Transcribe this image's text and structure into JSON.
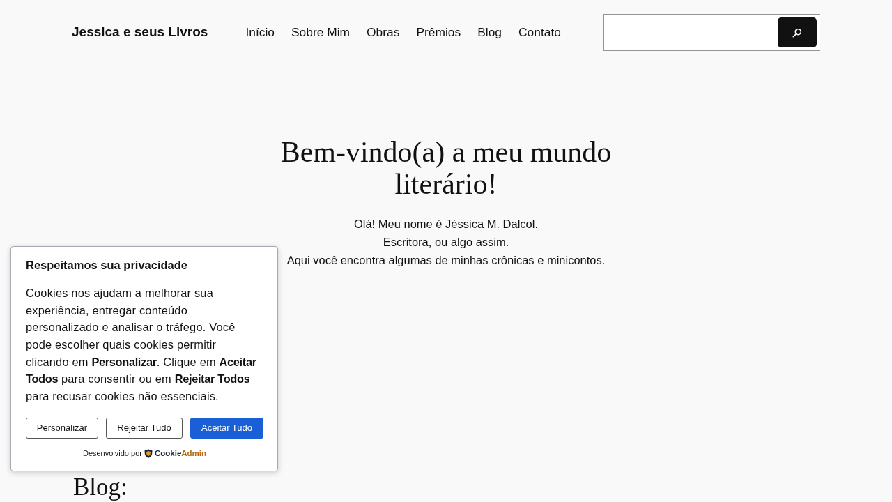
{
  "header": {
    "site_title": "Jessica e seus Livros",
    "nav": [
      {
        "label": "Início",
        "selected": false
      },
      {
        "label": "Sobre Mim",
        "selected": false
      },
      {
        "label": "Obras",
        "selected": false
      },
      {
        "label": "Prêmios",
        "selected": false
      },
      {
        "label": "Blog",
        "selected": false
      },
      {
        "label": "Contato",
        "selected": false
      }
    ]
  },
  "hero": {
    "heading": "Bem-vindo(a) a meu mundo literário!",
    "lines": [
      "Olá! Meu nome é Jéssica M. Dalcol.",
      "Escritora, ou algo assim.",
      "Aqui você encontra algumas de minhas crônicas e minicontos."
    ]
  },
  "blog_section": {
    "heading": "Blog:"
  },
  "cookie_banner": {
    "title": "Respeitamos sua privacidade",
    "message": "Cookies nos ajudam a melhorar sua experiência, entregar conteúdo personalizado e analisar o tráfego. Você pode escolher quais cookies permitir clicando em **Personalizar**. Clique em **Aceitar Todos** para consentir ou em **Rejeitar Todos** para recusar cookies não essenciais.",
    "buttons": [
      {
        "label": "Personalizar",
        "kind": "outline"
      },
      {
        "label": "Rejeitar Tudo",
        "kind": "outline"
      },
      {
        "label": "Aceitar Tudo",
        "kind": "primary"
      }
    ],
    "powered_by": {
      "label": "Desenvolvido por",
      "brand_parts": [
        "Cookie",
        "Admin"
      ]
    }
  }
}
